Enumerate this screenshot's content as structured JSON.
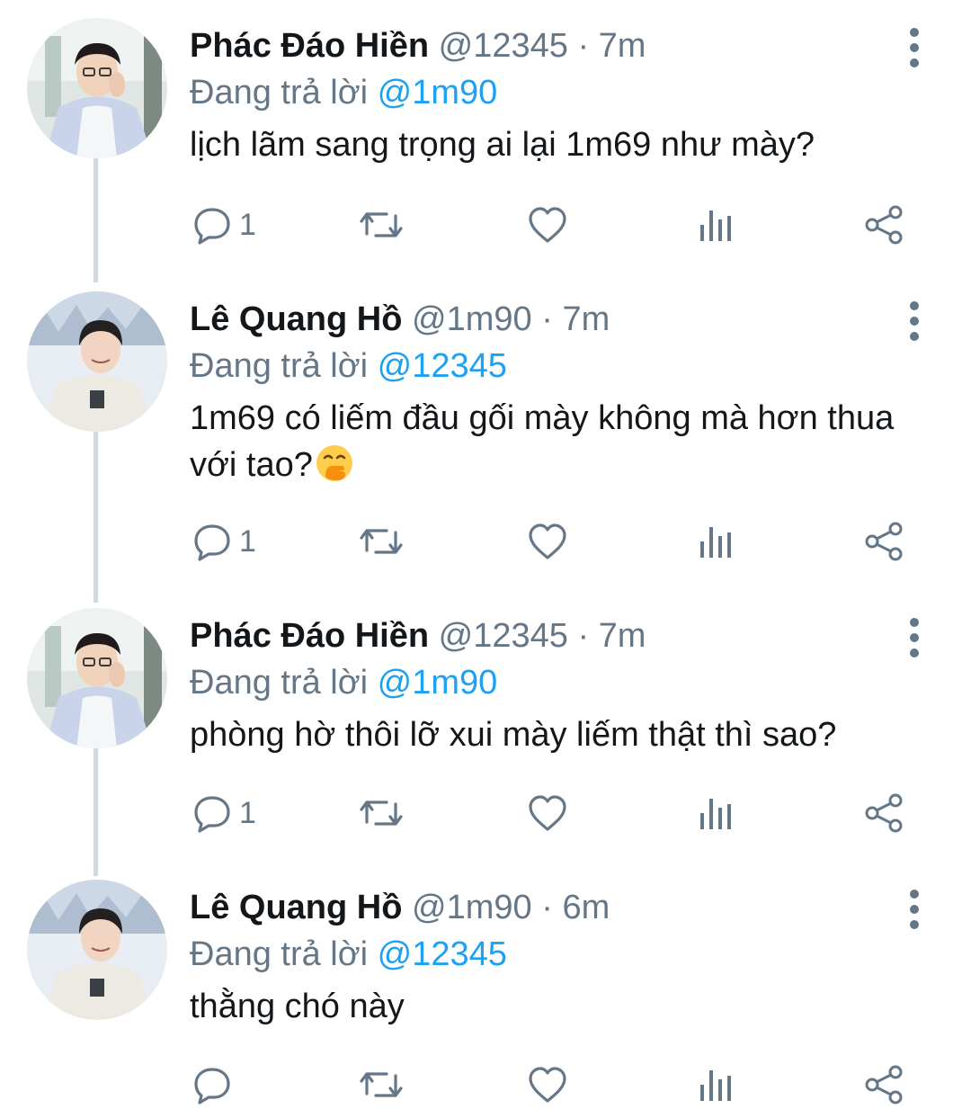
{
  "tweets": [
    {
      "name": "Phác Đáo Hiền",
      "handle": "@12345",
      "dot": "·",
      "time": "7m",
      "reply_prefix": "Đang trả lời ",
      "reply_to": "@1m90",
      "text": "lịch lãm sang trọng ai lại 1m69 như mày?",
      "reply_count": "1"
    },
    {
      "name": "Lê Quang Hồ",
      "handle": "@1m90",
      "dot": "·",
      "time": "7m",
      "reply_prefix": "Đang trả lời ",
      "reply_to": "@12345",
      "text": "1m69 có liếm đầu gối mày không mà hơn thua với tao?",
      "reply_count": "1"
    },
    {
      "name": "Phác Đáo Hiền",
      "handle": "@12345",
      "dot": "·",
      "time": "7m",
      "reply_prefix": "Đang trả lời ",
      "reply_to": "@1m90",
      "text": "phòng hờ thôi lỡ xui mày liếm thật thì sao?",
      "reply_count": "1"
    },
    {
      "name": "Lê Quang Hồ",
      "handle": "@1m90",
      "dot": "·",
      "time": "6m",
      "reply_prefix": "Đang trả lời ",
      "reply_to": "@12345",
      "text": "thằng chó này",
      "reply_count": ""
    }
  ],
  "icons": {
    "reply": "reply-icon",
    "retweet": "retweet-icon",
    "like": "like-icon",
    "analytics": "analytics-icon",
    "share": "share-icon",
    "more": "more-options-icon",
    "emoji": "face-with-hand-over-mouth-emoji"
  },
  "colors": {
    "text": "#14171a",
    "secondary": "#657786",
    "mention": "#1da1f2",
    "thread_line": "#cfd9de"
  }
}
